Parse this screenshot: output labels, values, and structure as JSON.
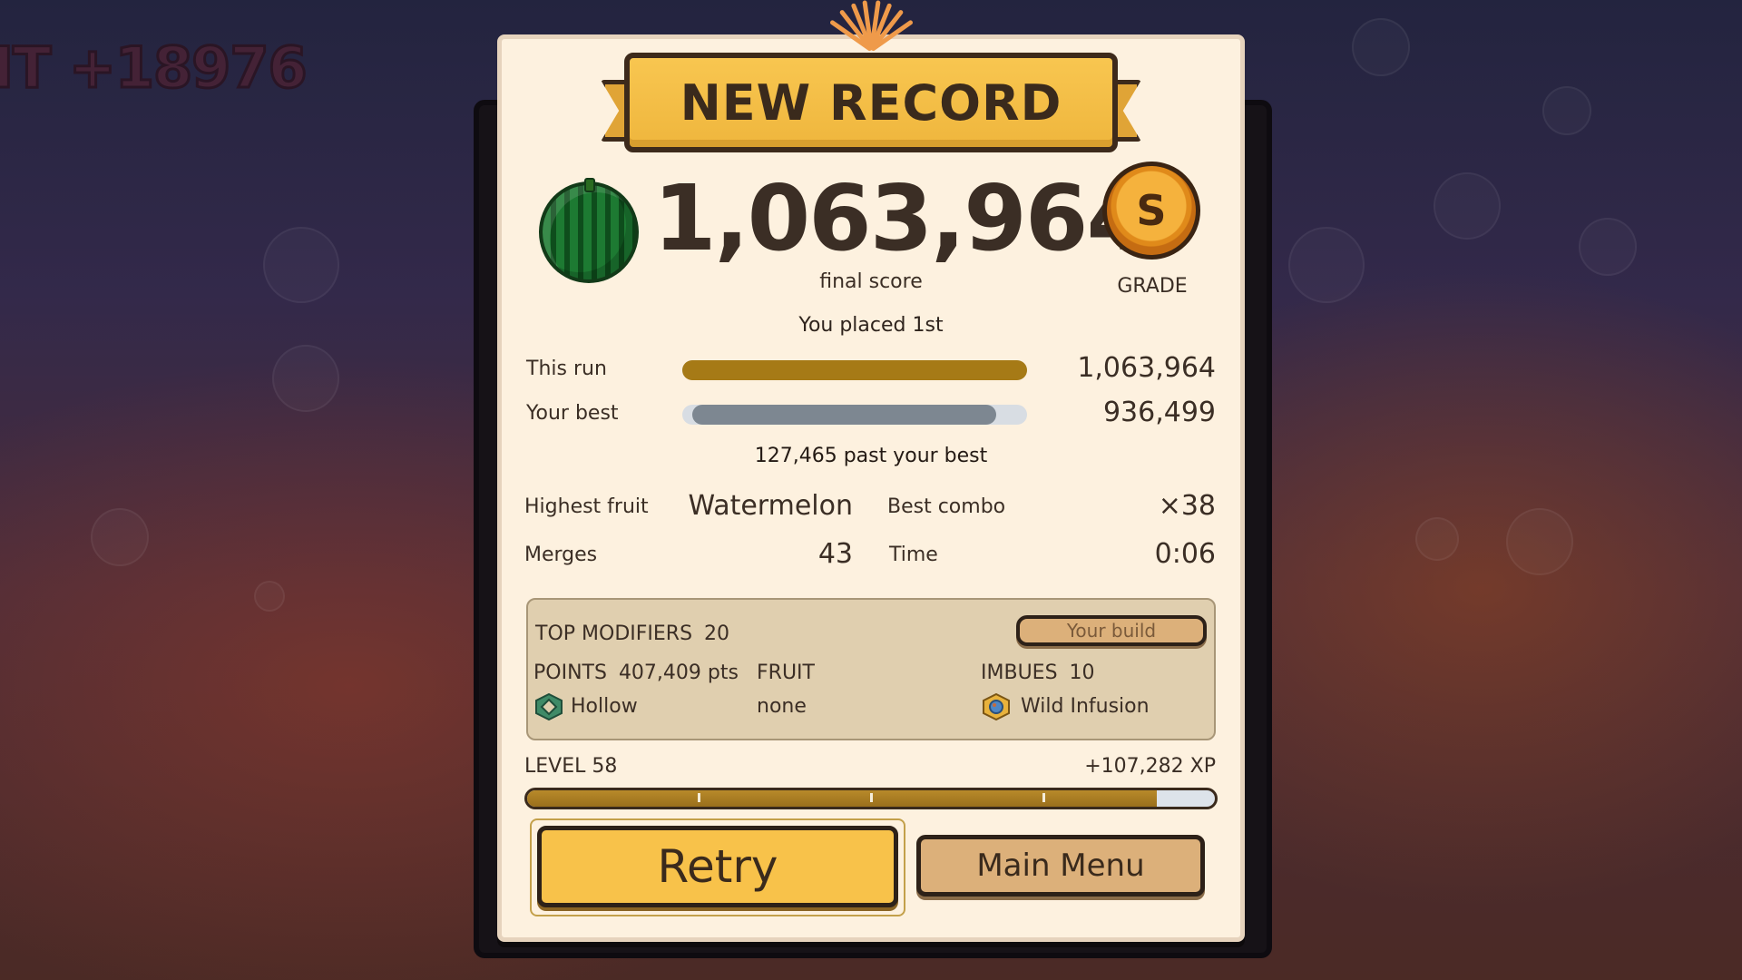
{
  "hud": {
    "score_popup": "IT +18976"
  },
  "header": {
    "title": "NEW RECORD"
  },
  "result": {
    "final_score": "1,063,964",
    "final_score_label": "final score",
    "grade": "S",
    "grade_label": "GRADE",
    "placement": "You placed 1st",
    "fruit_icon": "watermelon-icon"
  },
  "comparison": {
    "this_run_label": "This run",
    "this_run_value": "1,063,964",
    "this_run_fraction": 1.0,
    "best_label": "Your best",
    "best_value": "936,499",
    "best_fraction": 0.88,
    "difference_text": "127,465 past your best",
    "colors": {
      "this_run": "#a67a16",
      "best": "#7d8791",
      "track": "#d8dde3"
    }
  },
  "stats": {
    "highest_fruit_label": "Highest fruit",
    "highest_fruit_value": "Watermelon",
    "best_combo_label": "Best combo",
    "best_combo_value": "×38",
    "merges_label": "Merges",
    "merges_value": "43",
    "time_label": "Time",
    "time_value": "0:06"
  },
  "modifiers": {
    "header": "TOP MODIFIERS",
    "count": "20",
    "build_button": "Your build",
    "points_label": "POINTS",
    "points_value": "407,409 pts",
    "points_item": "Hollow",
    "points_item_icon": "hollow-diamond-icon",
    "fruit_label": "FRUIT",
    "fruit_value": "none",
    "imbues_label": "IMBUES",
    "imbues_count": "10",
    "imbues_item": "Wild Infusion",
    "imbues_item_icon": "wild-infusion-icon"
  },
  "level": {
    "label": "LEVEL 58",
    "xp_gain": "+107,282 XP",
    "progress_fraction": 0.915
  },
  "buttons": {
    "retry": "Retry",
    "main_menu": "Main Menu"
  }
}
